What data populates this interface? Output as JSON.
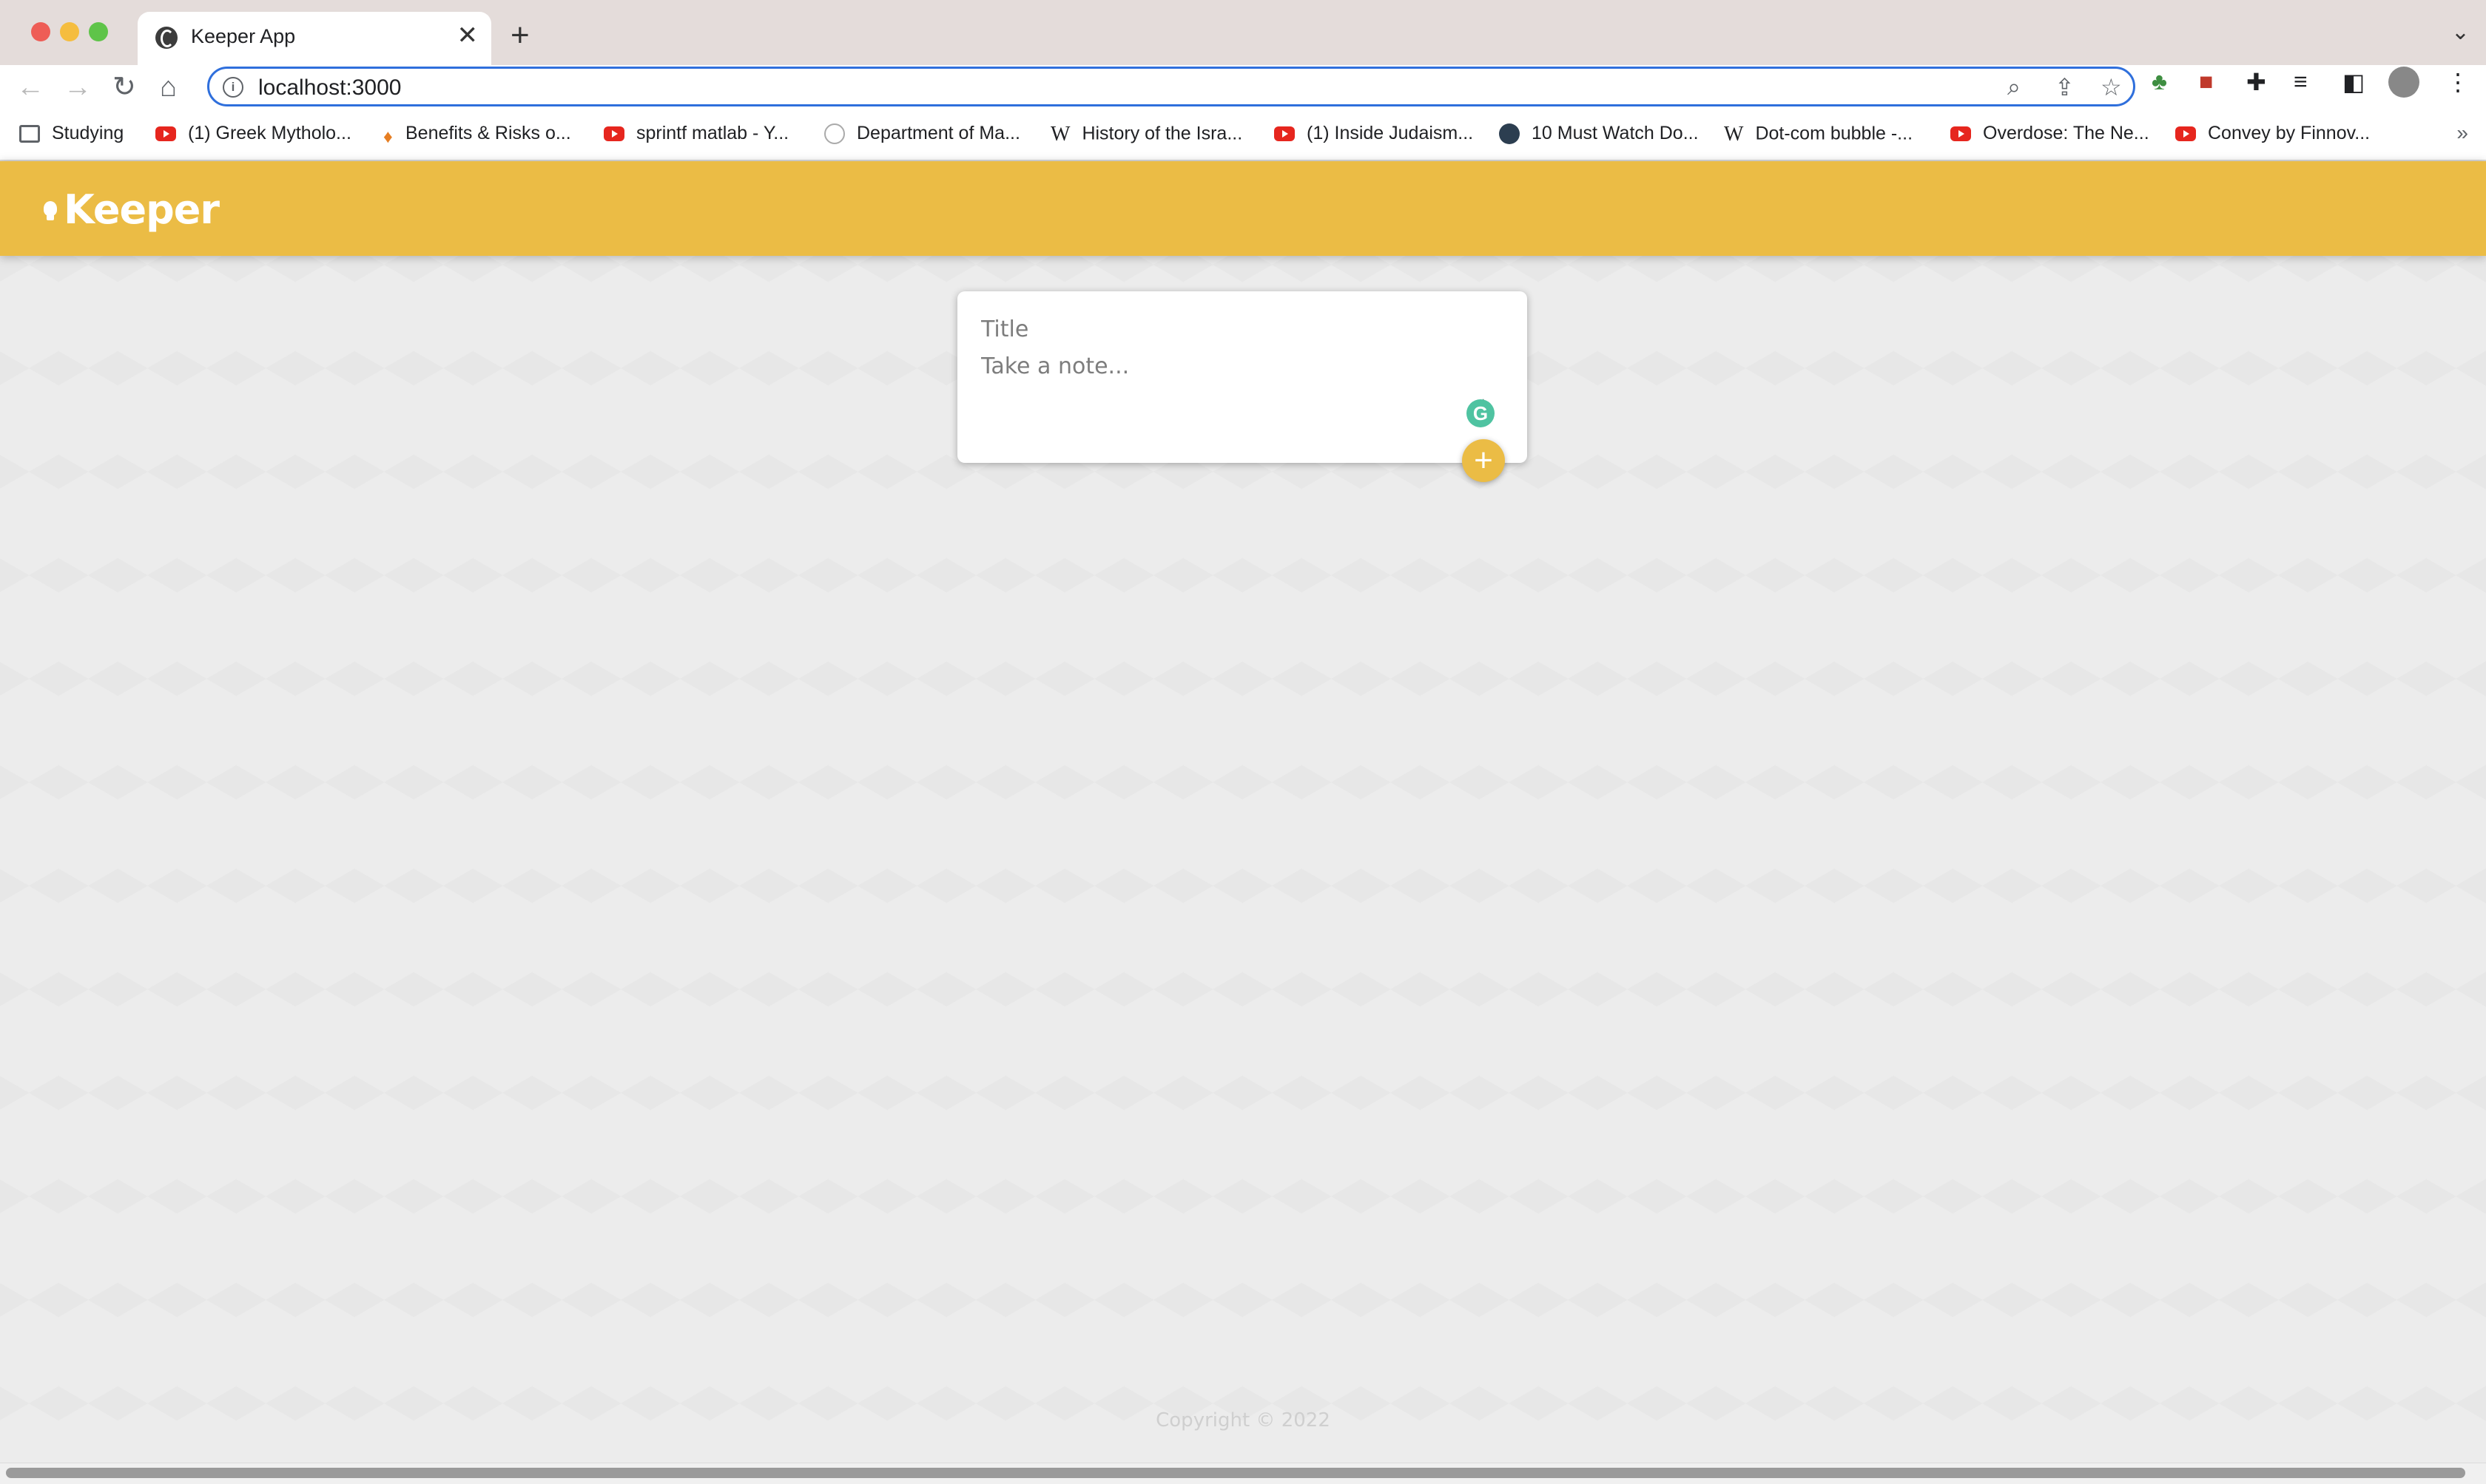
{
  "browser": {
    "tab_title": "Keeper App",
    "tab_close": "✕",
    "new_tab": "+",
    "url": "localhost:3000",
    "bookmarks": [
      {
        "label": "Studying",
        "icon": "folder-icon"
      },
      {
        "label": "(1) Greek Mytholo...",
        "icon": "youtube-icon"
      },
      {
        "label": "Benefits & Risks o...",
        "icon": "flame-icon"
      },
      {
        "label": "sprintf matlab - Y...",
        "icon": "youtube-icon"
      },
      {
        "label": "Department of Ma...",
        "icon": "seal-icon"
      },
      {
        "label": "History of the Isra...",
        "icon": "wikipedia-icon"
      },
      {
        "label": "(1) Inside Judaism...",
        "icon": "youtube-icon"
      },
      {
        "label": "10 Must Watch Do...",
        "icon": "site-icon"
      },
      {
        "label": "Dot-com bubble -...",
        "icon": "wikipedia-icon"
      },
      {
        "label": "Overdose: The Ne...",
        "icon": "youtube-icon"
      },
      {
        "label": "Convey by Finnov...",
        "icon": "youtube-icon"
      }
    ],
    "bookmarks_more": "»"
  },
  "app": {
    "logo_text": "Keeper",
    "form": {
      "title_placeholder": "Title",
      "content_placeholder": "Take a note...",
      "add_label": "+"
    },
    "footer": "Copyright © 2022"
  },
  "colors": {
    "header": "#ebbc45",
    "accent": "#ebbc45",
    "grammarly": "#4fc3a1"
  }
}
